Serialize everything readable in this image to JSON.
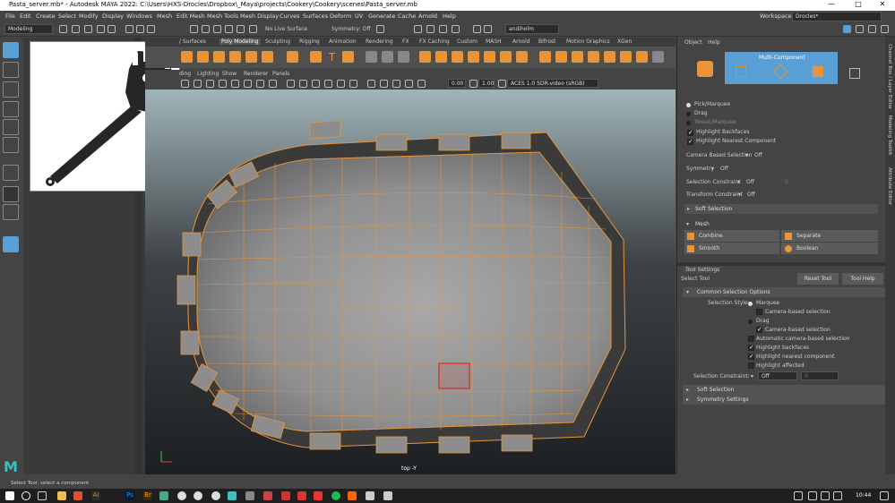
{
  "window": {
    "title": "Pasta_server.mb* - Autodesk MAYA 2022: C:\\Users\\HXS-Drocles\\Dropbox\\_Maya\\projects\\Cookery\\Cookery\\scenes\\Pasta_server.mb",
    "min": "—",
    "max": "□",
    "close": "✕"
  },
  "menu": [
    "File",
    "Edit",
    "Create",
    "Select",
    "Modify",
    "Display",
    "Windows",
    "Mesh",
    "Edit Mesh",
    "Mesh Tools",
    "Mesh Display",
    "Curves",
    "Surfaces",
    "Deform",
    "UV",
    "Generate",
    "Cache",
    "Arnold",
    "Help"
  ],
  "workspace": {
    "label": "Workspace :",
    "value": "Drocles*"
  },
  "statusline": {
    "mode": "Modeling",
    "live": "No Live Surface",
    "symmetry": "Symmetry: Off",
    "user": "andiholm"
  },
  "shelf_tabs": [
    "/ Surfaces",
    "Poly Modeling",
    "Sculpting",
    "Rigging",
    "Animation",
    "Rendering",
    "FX",
    "FX Caching",
    "Custom",
    "MASH",
    "Arnold",
    "Bifrost",
    "Motion Graphics",
    "XGen"
  ],
  "shelf_active": "Poly Modeling",
  "panel_menu": [
    "Lighting",
    "Show",
    "Renderer",
    "Panels"
  ],
  "panel_menu_partial": "ding",
  "panel_toolbar": {
    "exposure": "0.00",
    "gamma": "1.00",
    "colorspace": "ACES 1.0 SDR-video (sRGB)"
  },
  "viewport": {
    "camera_label": "top -Y"
  },
  "right_tabs": [
    "Object",
    "Help"
  ],
  "multi_component": "Multi-Component",
  "modeling_toolkit": {
    "pick": "Pick/Marquee",
    "drag": "Drag",
    "tweak": "Tweak/Marquee",
    "highlight_backfaces": "Highlight Backfaces",
    "highlight_nearest": "Highlight Nearest Component",
    "camera_based": "Camera Based Selection",
    "camera_based_value": "Off",
    "symmetry": "Symmetry",
    "symmetry_value": "Off",
    "selection_constraint": "Selection Constraint",
    "selection_constraint_value": "Off",
    "selection_constraint_num": "0",
    "transform_constraint": "Transform Constraint",
    "transform_constraint_value": "Off",
    "soft_selection": "Soft Selection",
    "mesh": "Mesh",
    "combine": "Combine",
    "separate": "Separate",
    "smooth": "Smooth",
    "boolean": "Boolean"
  },
  "tool_settings": {
    "tab": "Tool Settings",
    "tool": "Select Tool",
    "reset": "Reset Tool",
    "help": "Tool Help",
    "common": "Common Selection Options",
    "style_label": "Selection Style:",
    "marquee": "Marquee",
    "camera_based1": "Camera-based selection",
    "drag": "Drag",
    "camera_based2": "Camera-based selection",
    "auto_camera": "Automatic camera-based selection",
    "highlight_backfaces": "Highlight backfaces",
    "highlight_nearest": "Highlight nearest component",
    "highlight_affected": "Highlight affected",
    "constraint_label": "Selection Constraint:",
    "constraint_value": "Off",
    "constraint_num": "0",
    "soft_selection": "Soft Selection",
    "symmetry_settings": "Symmetry Settings"
  },
  "side_strip": [
    "Channel Box / Layer Editor",
    "Modeling Toolkit",
    "Attribute Editor"
  ],
  "help_line": "Select Tool: select a component",
  "taskbar": {
    "time": "10:44"
  },
  "colors": {
    "wire": "#e8953a",
    "accent": "#5a9fd4",
    "selection": "#d62a2a"
  }
}
